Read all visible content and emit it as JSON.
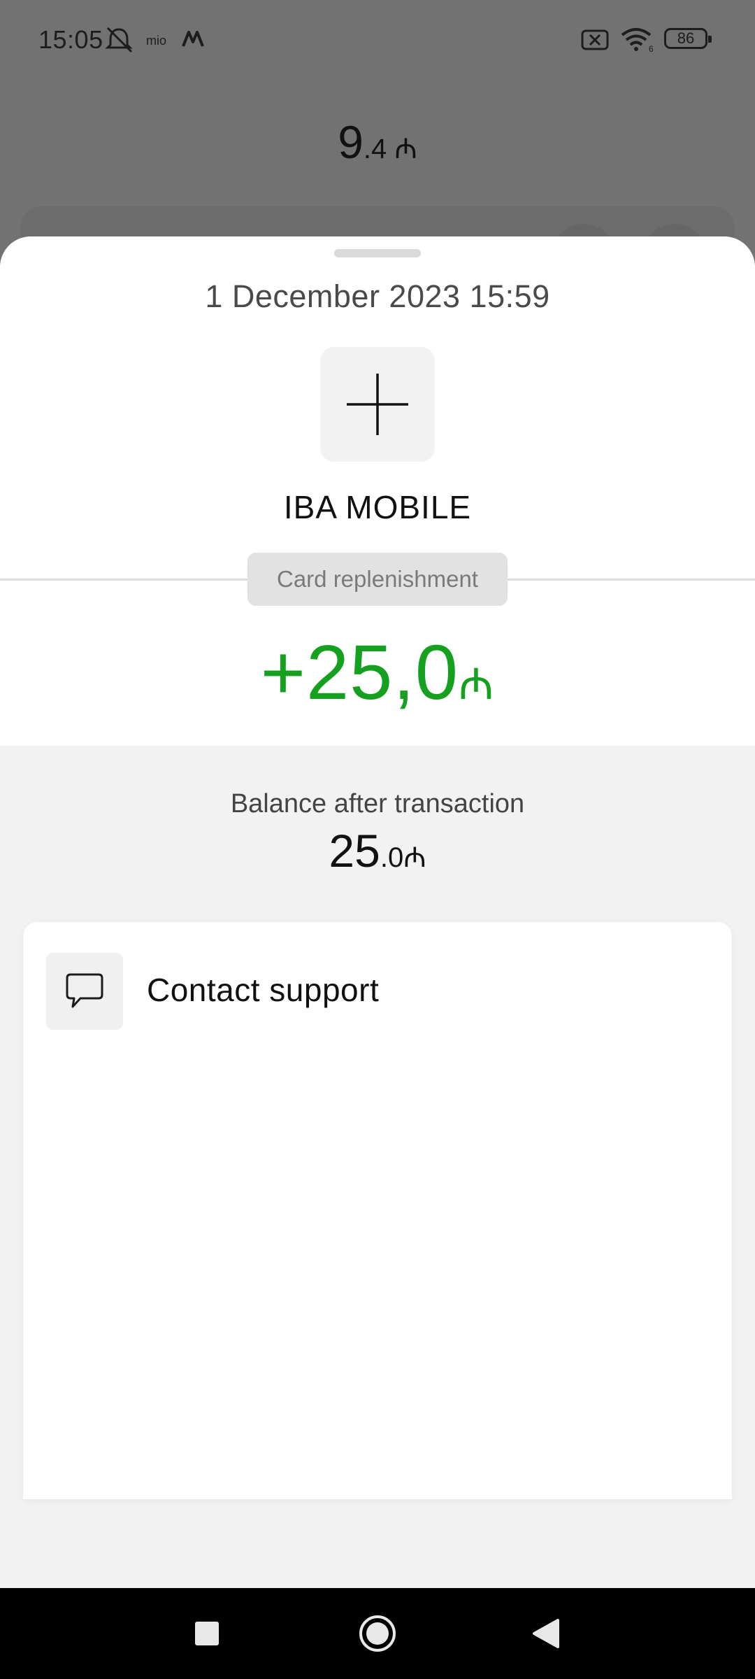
{
  "status_bar": {
    "time": "15:05",
    "battery": "86",
    "wifi_badge": "6"
  },
  "background": {
    "balance_int": "9",
    "balance_frac": ".4 ₼"
  },
  "transaction": {
    "date": "1 December 2023 15:59",
    "merchant": "IBA MOBILE",
    "category": "Card replenishment",
    "amount": "+25,0",
    "currency": "₼",
    "amount_color": "#15a020"
  },
  "balance_after": {
    "label": "Balance after transaction",
    "int": "25",
    "frac": ".0₼"
  },
  "support": {
    "label": "Contact support"
  },
  "icons": {
    "merchant": "plus-icon",
    "support": "chat-bubble-icon",
    "nav": [
      "recents-square-icon",
      "home-circle-icon",
      "back-triangle-icon"
    ]
  }
}
